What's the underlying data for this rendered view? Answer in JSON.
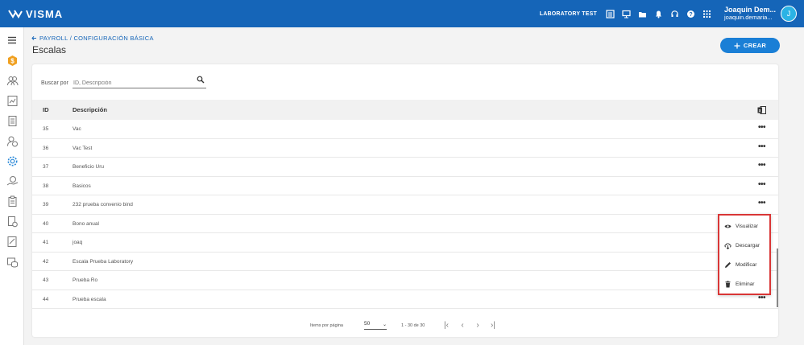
{
  "topbar": {
    "brand": "VISMA",
    "company": "LABORATORY TEST",
    "user_name": "Joaquin Dem...",
    "user_email": "joaquin.demaria...",
    "avatar_initial": "J",
    "color": "#1565b8"
  },
  "header": {
    "breadcrumb": "PAYROLL / CONFIGURACIÓN BÁSICA",
    "title": "Escalas",
    "create_label": "CREAR"
  },
  "search": {
    "label": "Buscar por",
    "placeholder": "ID, Descripción"
  },
  "table": {
    "columns": [
      "ID",
      "Descripción"
    ],
    "rows": [
      {
        "id": "35",
        "desc": "Vac"
      },
      {
        "id": "36",
        "desc": "Vac Test"
      },
      {
        "id": "37",
        "desc": "Beneficio Uru"
      },
      {
        "id": "38",
        "desc": "Basicos"
      },
      {
        "id": "39",
        "desc": "232 prueba convenio bind"
      },
      {
        "id": "40",
        "desc": "Bono anual"
      },
      {
        "id": "41",
        "desc": "joaq"
      },
      {
        "id": "42",
        "desc": "Escala Prueba Laboratory"
      },
      {
        "id": "43",
        "desc": "Prueba Ro"
      },
      {
        "id": "44",
        "desc": "Prueba escala"
      }
    ],
    "row_menu_label": "•••"
  },
  "pager": {
    "items_label": "Items por página",
    "page_size": "50",
    "range": "1 - 30 de 30"
  },
  "context_menu": {
    "items": [
      "Visualizar",
      "Descargar",
      "Modificar",
      "Eliminar"
    ],
    "highlight_color": "#d93636"
  }
}
